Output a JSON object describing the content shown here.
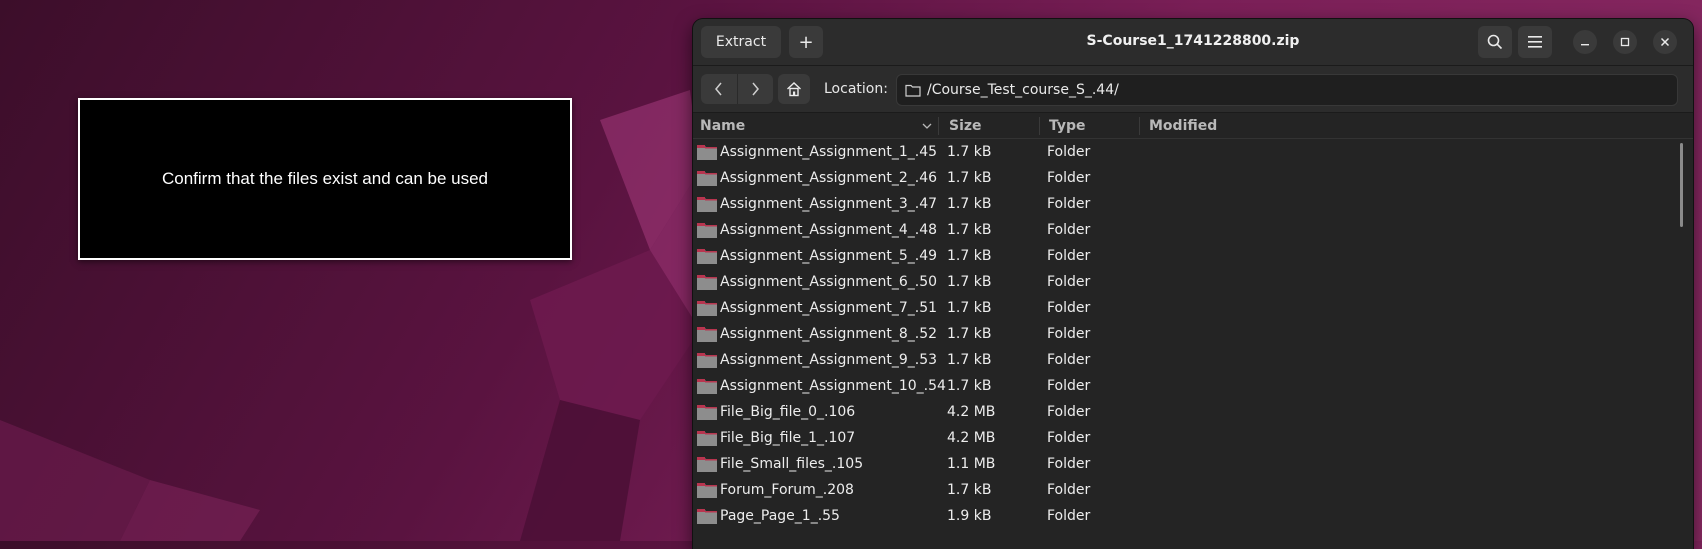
{
  "overlay": {
    "message": "Confirm that the files exist and can be used"
  },
  "window": {
    "title": "S-Course1_1741228800.zip",
    "extract_label": "Extract",
    "add_label": "+",
    "location_label": "Location:",
    "location_path": "/Course_Test_course_S_.44/"
  },
  "columns": {
    "name": "Name",
    "size": "Size",
    "type": "Type",
    "modified": "Modified"
  },
  "files": [
    {
      "name": "Assignment_Assignment_1_.45",
      "size": "1.7 kB",
      "type": "Folder"
    },
    {
      "name": "Assignment_Assignment_2_.46",
      "size": "1.7 kB",
      "type": "Folder"
    },
    {
      "name": "Assignment_Assignment_3_.47",
      "size": "1.7 kB",
      "type": "Folder"
    },
    {
      "name": "Assignment_Assignment_4_.48",
      "size": "1.7 kB",
      "type": "Folder"
    },
    {
      "name": "Assignment_Assignment_5_.49",
      "size": "1.7 kB",
      "type": "Folder"
    },
    {
      "name": "Assignment_Assignment_6_.50",
      "size": "1.7 kB",
      "type": "Folder"
    },
    {
      "name": "Assignment_Assignment_7_.51",
      "size": "1.7 kB",
      "type": "Folder"
    },
    {
      "name": "Assignment_Assignment_8_.52",
      "size": "1.7 kB",
      "type": "Folder"
    },
    {
      "name": "Assignment_Assignment_9_.53",
      "size": "1.7 kB",
      "type": "Folder"
    },
    {
      "name": "Assignment_Assignment_10_.54",
      "size": "1.7 kB",
      "type": "Folder"
    },
    {
      "name": "File_Big_file_0_.106",
      "size": "4.2 MB",
      "type": "Folder"
    },
    {
      "name": "File_Big_file_1_.107",
      "size": "4.2 MB",
      "type": "Folder"
    },
    {
      "name": "File_Small_files_.105",
      "size": "1.1 MB",
      "type": "Folder"
    },
    {
      "name": "Forum_Forum_.208",
      "size": "1.7 kB",
      "type": "Folder"
    },
    {
      "name": "Page_Page_1_.55",
      "size": "1.9 kB",
      "type": "Folder"
    }
  ],
  "icons": {
    "search": "search-icon",
    "menu": "hamburger-menu-icon",
    "minimize": "minimize-icon",
    "maximize": "maximize-icon",
    "close": "close-icon",
    "back": "chevron-left-icon",
    "forward": "chevron-right-icon",
    "home": "home-icon",
    "folder": "folder-icon",
    "sort": "chevron-down-icon"
  },
  "colors": {
    "folder": "#b8354f",
    "window_bg": "#242424",
    "desktop": "#5a1340"
  }
}
